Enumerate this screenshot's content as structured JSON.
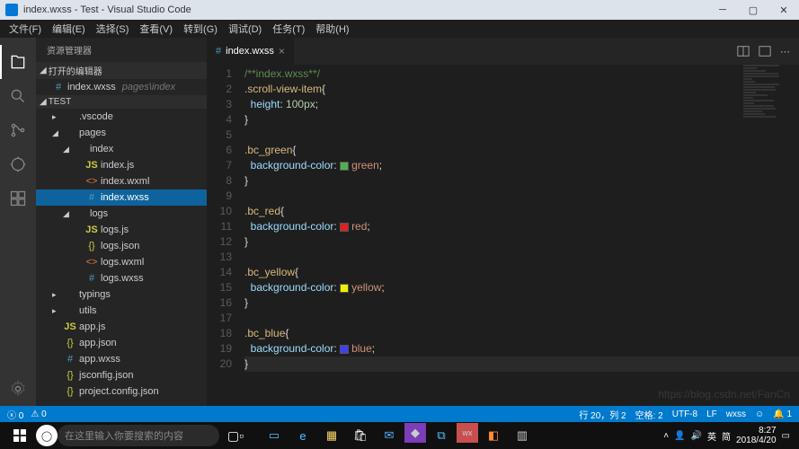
{
  "titlebar": {
    "title": "index.wxss - Test - Visual Studio Code"
  },
  "menubar": [
    "文件(F)",
    "编辑(E)",
    "选择(S)",
    "查看(V)",
    "转到(G)",
    "调试(D)",
    "任务(T)",
    "帮助(H)"
  ],
  "sidebar": {
    "title": "资源管理器",
    "open_editors": "打开的编辑器",
    "open_file": {
      "name": "index.wxss",
      "path": "pages\\index"
    },
    "root": "TEST",
    "tree": [
      {
        "label": ".vscode",
        "type": "folder",
        "indent": 1,
        "open": false
      },
      {
        "label": "pages",
        "type": "folder",
        "indent": 1,
        "open": true
      },
      {
        "label": "index",
        "type": "folder",
        "indent": 2,
        "open": true
      },
      {
        "label": "index.js",
        "type": "js",
        "indent": 3
      },
      {
        "label": "index.wxml",
        "type": "angle",
        "indent": 3
      },
      {
        "label": "index.wxss",
        "type": "hash",
        "indent": 3,
        "active": true
      },
      {
        "label": "logs",
        "type": "folder",
        "indent": 2,
        "open": true
      },
      {
        "label": "logs.js",
        "type": "js",
        "indent": 3
      },
      {
        "label": "logs.json",
        "type": "brace",
        "indent": 3
      },
      {
        "label": "logs.wxml",
        "type": "angle",
        "indent": 3
      },
      {
        "label": "logs.wxss",
        "type": "hash",
        "indent": 3
      },
      {
        "label": "typings",
        "type": "folder",
        "indent": 1,
        "open": false
      },
      {
        "label": "utils",
        "type": "folder",
        "indent": 1,
        "open": false
      },
      {
        "label": "app.js",
        "type": "js",
        "indent": 1
      },
      {
        "label": "app.json",
        "type": "brace",
        "indent": 1
      },
      {
        "label": "app.wxss",
        "type": "hash",
        "indent": 1
      },
      {
        "label": "jsconfig.json",
        "type": "brace",
        "indent": 1
      },
      {
        "label": "project.config.json",
        "type": "brace",
        "indent": 1
      }
    ]
  },
  "tab": {
    "label": "index.wxss"
  },
  "code": {
    "lines": 20,
    "current_line": 20,
    "content": [
      {
        "t": "comment",
        "text": "/**index.wxss**/"
      },
      {
        "t": "rule",
        "sel": ".scroll-view-item",
        "open": true
      },
      {
        "t": "prop",
        "prop": "height",
        "val": "100px",
        "num": true
      },
      {
        "t": "close"
      },
      {
        "t": "blank"
      },
      {
        "t": "rule",
        "sel": ".bc_green",
        "open": true
      },
      {
        "t": "prop",
        "prop": "background-color",
        "val": "green",
        "color": "#50b050"
      },
      {
        "t": "close"
      },
      {
        "t": "blank"
      },
      {
        "t": "rule",
        "sel": ".bc_red",
        "open": true
      },
      {
        "t": "prop",
        "prop": "background-color",
        "val": "red",
        "color": "#e02020"
      },
      {
        "t": "close"
      },
      {
        "t": "blank"
      },
      {
        "t": "rule",
        "sel": ".bc_yellow",
        "open": true
      },
      {
        "t": "prop",
        "prop": "background-color",
        "val": "yellow",
        "color": "#f0f000"
      },
      {
        "t": "close"
      },
      {
        "t": "blank"
      },
      {
        "t": "rule",
        "sel": ".bc_blue",
        "open": true
      },
      {
        "t": "prop",
        "prop": "background-color",
        "val": "blue",
        "color": "#4040f0"
      },
      {
        "t": "close",
        "current": true
      }
    ]
  },
  "statusbar": {
    "errors": "0",
    "warnings": "0",
    "line_col": "行 20，列 2",
    "spaces": "空格: 2",
    "encoding": "UTF-8",
    "eol": "LF",
    "lang": "wxss",
    "feedback": "☺",
    "bell": "1"
  },
  "taskbar": {
    "search_placeholder": "在这里输入你要搜索的内容",
    "time": "8:27",
    "date": "2018/4/20",
    "ime1": "英",
    "ime2": "简"
  },
  "watermark": "https://blog.csdn.net/FanCn"
}
